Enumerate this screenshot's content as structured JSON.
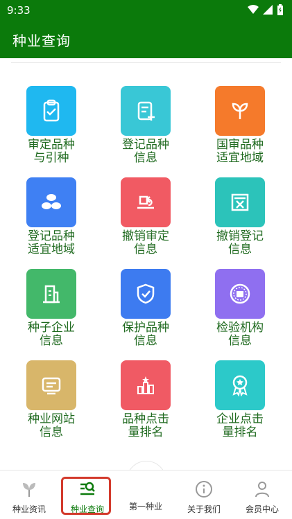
{
  "status": {
    "time": "9:33"
  },
  "header": {
    "title": "种业查询"
  },
  "grid": {
    "items": [
      {
        "label": "审定品种\n与引种",
        "icon": "clipboard-check-icon",
        "color": "#1fb8f0"
      },
      {
        "label": "登记品种\n信息",
        "icon": "register-plus-icon",
        "color": "#39c7d6"
      },
      {
        "label": "国审品种\n适宜地域",
        "icon": "sprout-icon",
        "color": "#f57a2b"
      },
      {
        "label": "登记品种\n适宜地域",
        "icon": "seed-beans-icon",
        "color": "#3f80f3"
      },
      {
        "label": "撤销审定\n信息",
        "icon": "revoke-stamp-icon",
        "color": "#f15a63"
      },
      {
        "label": "撤销登记\n信息",
        "icon": "revoke-box-icon",
        "color": "#2cc3ba"
      },
      {
        "label": "种子企业\n信息",
        "icon": "building-icon",
        "color": "#43b86a"
      },
      {
        "label": "保护品种\n信息",
        "icon": "shield-check-icon",
        "color": "#3d7bf0"
      },
      {
        "label": "检验机构\n信息",
        "icon": "institution-seal-icon",
        "color": "#8f6ff0"
      },
      {
        "label": "种业网站\n信息",
        "icon": "website-screen-icon",
        "color": "#d8b66a"
      },
      {
        "label": "品种点击\n量排名",
        "icon": "ranking-podium-icon",
        "color": "#f05a64"
      },
      {
        "label": "企业点击\n量排名",
        "icon": "award-medal-icon",
        "color": "#2cc9c9"
      }
    ]
  },
  "tabbar": {
    "tabs": [
      {
        "label": "种业资讯",
        "icon": "leaf-icon"
      },
      {
        "label": "种业查询",
        "icon": "query-search-icon"
      },
      {
        "label": "第一种业",
        "icon": "home-icon"
      },
      {
        "label": "关于我们",
        "icon": "info-icon"
      },
      {
        "label": "会员中心",
        "icon": "user-icon"
      }
    ]
  }
}
